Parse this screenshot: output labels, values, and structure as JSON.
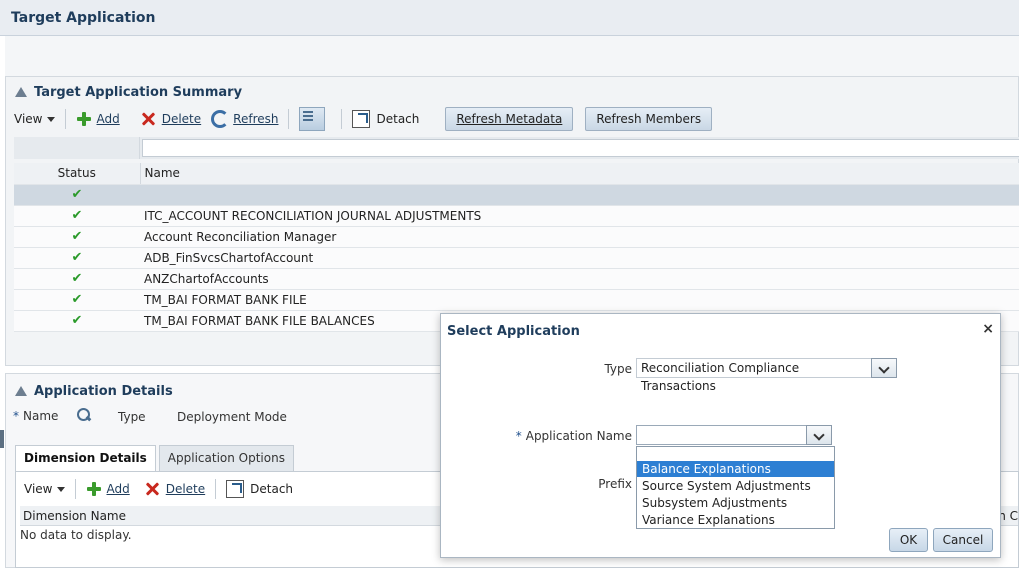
{
  "page": {
    "title": "Target Application"
  },
  "summary": {
    "title": "Target Application Summary",
    "toolbar": {
      "view": "View",
      "add": "Add",
      "delete": "Delete",
      "refresh": "Refresh",
      "detach": "Detach",
      "refresh_metadata": "Refresh Metadata",
      "refresh_members": "Refresh Members"
    },
    "columns": {
      "status": "Status",
      "name": "Name"
    },
    "rows": [
      {
        "name": ""
      },
      {
        "name": "ITC_ACCOUNT RECONCILIATION JOURNAL ADJUSTMENTS"
      },
      {
        "name": "Account Reconciliation Manager"
      },
      {
        "name": "ADB_FinSvcsChartofAccount"
      },
      {
        "name": "ANZChartofAccounts"
      },
      {
        "name": "TM_BAI FORMAT BANK FILE"
      },
      {
        "name": "TM_BAI FORMAT BANK FILE BALANCES"
      }
    ]
  },
  "details": {
    "title": "Application Details",
    "name_label": "Name",
    "type_label": "Type",
    "deployment_label": "Deployment Mode",
    "tabs": [
      "Dimension Details",
      "Application Options"
    ],
    "toolbar": {
      "view": "View",
      "add": "Add",
      "delete": "Delete",
      "detach": "Detach"
    },
    "columns": {
      "dimension_name": "Dimension Name",
      "partial_col": "n C"
    },
    "empty": "No data to display."
  },
  "dialog": {
    "title": "Select Application",
    "type_label": "Type",
    "type_value": "Reconciliation Compliance Transactions",
    "app_name_label": "Application Name",
    "app_name_value": "",
    "prefix_label": "Prefix",
    "options": [
      "Balance Explanations",
      "Source System Adjustments",
      "Subsystem Adjustments",
      "Variance Explanations"
    ],
    "ok": "OK",
    "cancel": "Cancel",
    "close": "×"
  },
  "colors": {
    "accent": "#1f3d5c",
    "highlight": "#2d7fd3",
    "check": "#2a9a2a"
  }
}
